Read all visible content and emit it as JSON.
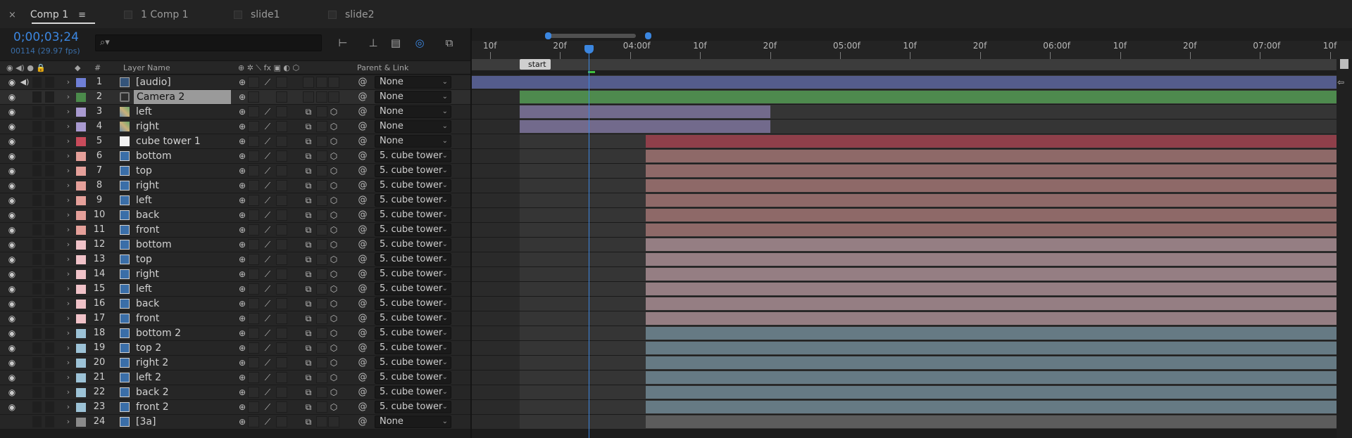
{
  "tabs": [
    {
      "label": "Comp 1",
      "active": true
    },
    {
      "label": "1 Comp 1",
      "active": false
    },
    {
      "label": "slide1",
      "active": false
    },
    {
      "label": "slide2",
      "active": false
    }
  ],
  "close_glyph": "×",
  "menu_glyph": "≡",
  "timecode": "0;00;03;24",
  "frames_fps": "00114 (29.97 fps)",
  "search": {
    "placeholder": "",
    "icon": "search-icon"
  },
  "columns": {
    "num": "#",
    "layer_name": "Layer Name",
    "parent_link": "Parent & Link"
  },
  "ruler": {
    "ticks": [
      "10f",
      "20f",
      "04:00f",
      "10f",
      "20f",
      "05:00f",
      "10f",
      "20f",
      "06:00f",
      "10f",
      "20f",
      "07:00f",
      "10f"
    ]
  },
  "marker": {
    "label": "start"
  },
  "current_frame": 114,
  "colors": {
    "accent": "#3b86e0",
    "label_blue": "#6f7fd6",
    "label_green": "#4b8a4b",
    "label_lavender": "#a99ad0",
    "label_red": "#c94b5b",
    "label_salmon": "#e5a09a",
    "label_pink": "#f0c2c8",
    "label_cyan": "#9cc2d6",
    "label_gray": "#8a8a8a"
  },
  "layers": [
    {
      "num": "1",
      "name": "[audio]",
      "label": "#6f7fd6",
      "type": "audio",
      "parent": "None",
      "bar_color": "#545c8c"
    },
    {
      "num": "2",
      "name": "Camera 2",
      "label": "#4b8a4b",
      "type": "camera",
      "parent": "None",
      "bar_color": "#4e8a4e",
      "selected": true
    },
    {
      "num": "3",
      "name": "left",
      "label": "#a99ad0",
      "type": "precomp",
      "parent": "None",
      "bar_color": "#726a8c"
    },
    {
      "num": "4",
      "name": "right",
      "label": "#a99ad0",
      "type": "precomp",
      "parent": "None",
      "bar_color": "#726a8c"
    },
    {
      "num": "5",
      "name": "cube tower 1",
      "label": "#c94b5b",
      "type": "solid",
      "parent": "None",
      "bar_color": "#8f3f4a"
    },
    {
      "num": "6",
      "name": "bottom",
      "label": "#e5a09a",
      "type": "image",
      "parent": "5. cube tower",
      "bar_color": "#8e6968"
    },
    {
      "num": "7",
      "name": "top",
      "label": "#e5a09a",
      "type": "image",
      "parent": "5. cube tower",
      "bar_color": "#8e6968"
    },
    {
      "num": "8",
      "name": "right",
      "label": "#e5a09a",
      "type": "image",
      "parent": "5. cube tower",
      "bar_color": "#8e6968"
    },
    {
      "num": "9",
      "name": "left",
      "label": "#e5a09a",
      "type": "image",
      "parent": "5. cube tower",
      "bar_color": "#8e6968"
    },
    {
      "num": "10",
      "name": "back",
      "label": "#e5a09a",
      "type": "image",
      "parent": "5. cube tower",
      "bar_color": "#8e6968"
    },
    {
      "num": "11",
      "name": "front",
      "label": "#e5a09a",
      "type": "image",
      "parent": "5. cube tower",
      "bar_color": "#8e6968"
    },
    {
      "num": "12",
      "name": "bottom",
      "label": "#f0c2c8",
      "type": "image",
      "parent": "5. cube tower",
      "bar_color": "#957e83"
    },
    {
      "num": "13",
      "name": "top",
      "label": "#f0c2c8",
      "type": "image",
      "parent": "5. cube tower",
      "bar_color": "#957e83"
    },
    {
      "num": "14",
      "name": "right",
      "label": "#f0c2c8",
      "type": "image",
      "parent": "5. cube tower",
      "bar_color": "#957e83"
    },
    {
      "num": "15",
      "name": "left",
      "label": "#f0c2c8",
      "type": "image",
      "parent": "5. cube tower",
      "bar_color": "#957e83"
    },
    {
      "num": "16",
      "name": "back",
      "label": "#f0c2c8",
      "type": "image",
      "parent": "5. cube tower",
      "bar_color": "#957e83"
    },
    {
      "num": "17",
      "name": "front",
      "label": "#f0c2c8",
      "type": "image",
      "parent": "5. cube tower",
      "bar_color": "#957e83"
    },
    {
      "num": "18",
      "name": "bottom 2",
      "label": "#9cc2d6",
      "type": "image",
      "parent": "5. cube tower",
      "bar_color": "#667a84"
    },
    {
      "num": "19",
      "name": "top 2",
      "label": "#9cc2d6",
      "type": "image",
      "parent": "5. cube tower",
      "bar_color": "#667a84"
    },
    {
      "num": "20",
      "name": "right 2",
      "label": "#9cc2d6",
      "type": "image",
      "parent": "5. cube tower",
      "bar_color": "#667a84"
    },
    {
      "num": "21",
      "name": "left 2",
      "label": "#9cc2d6",
      "type": "image",
      "parent": "5. cube tower",
      "bar_color": "#667a84"
    },
    {
      "num": "22",
      "name": "back 2",
      "label": "#9cc2d6",
      "type": "image",
      "parent": "5. cube tower",
      "bar_color": "#667a84"
    },
    {
      "num": "23",
      "name": "front 2",
      "label": "#9cc2d6",
      "type": "image",
      "parent": "5. cube tower",
      "bar_color": "#667a84"
    },
    {
      "num": "24",
      "name": "[3a]",
      "label": "#8a8a8a",
      "type": "image",
      "parent": "None",
      "bar_color": "#5c5c5c"
    }
  ]
}
